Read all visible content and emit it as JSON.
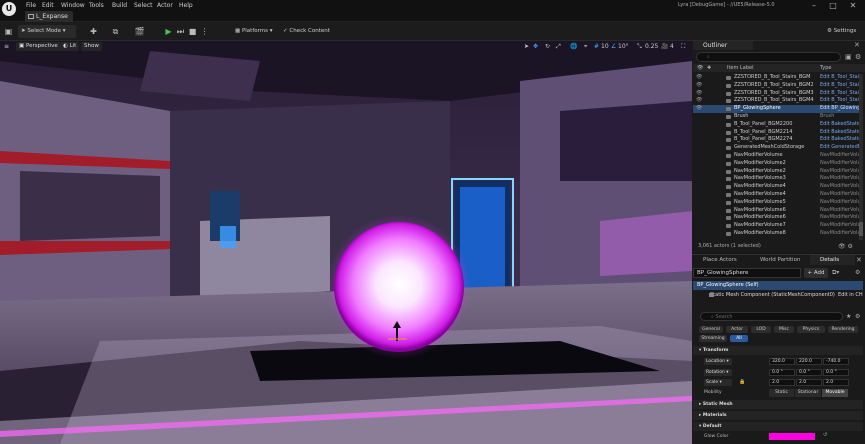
{
  "titlebar": {
    "logo": "U",
    "menus": [
      "File",
      "Edit",
      "Window",
      "Tools",
      "Build",
      "Select",
      "Actor",
      "Help"
    ],
    "project_tab": "L_Expanse",
    "window_title": "Lyra [DebugGame] - //UE5/Release-5.0",
    "controls": [
      "–",
      "□",
      "✕"
    ]
  },
  "toolbar": {
    "select_mode": "Select Mode",
    "platforms": "Platforms",
    "check_content": "Check Content",
    "settings": "Settings"
  },
  "viewport": {
    "perspective": "Perspective",
    "lit": "Lit",
    "show": "Show",
    "grid_snap": "10",
    "angle_snap": "10°",
    "scale_snap": "0.25",
    "camera_speed": "4"
  },
  "outliner": {
    "tab": "Outliner",
    "columns": {
      "label": "Item Label",
      "type": "Type"
    },
    "rows": [
      {
        "label": "ZZSTORED_B_Tool_Stairs_BGM",
        "type": "Edit B_Tool_Stai",
        "link": true,
        "eye": true
      },
      {
        "label": "ZZSTORED_B_Tool_Stairs_BGM2",
        "type": "Edit B_Tool_Stai",
        "link": true,
        "eye": true
      },
      {
        "label": "ZZSTORED_B_Tool_Stairs_BGM3",
        "type": "Edit B_Tool_Stai",
        "link": true,
        "eye": true
      },
      {
        "label": "ZZSTORED_B_Tool_Stairs_BGM4",
        "type": "Edit B_Tool_Stai",
        "link": true,
        "eye": true
      },
      {
        "label": "BP_GlowingSphere",
        "type": "Edit BP_Glowing",
        "link": true,
        "selected": true,
        "eye": true
      },
      {
        "label": "Brush",
        "type": "Brush",
        "link": false
      },
      {
        "label": "B_Tool_Panel_BGM2200",
        "type": "Edit BakedStatic",
        "link": true
      },
      {
        "label": "B_Tool_Panel_BGM2214",
        "type": "Edit BakedStatic",
        "link": true
      },
      {
        "label": "B_Tool_Panel_BGM2274",
        "type": "Edit BakedStatic",
        "link": true
      },
      {
        "label": "GeneratedMeshColdStorage",
        "type": "Edit GeneratedM",
        "link": true
      },
      {
        "label": "NavModifierVolume",
        "type": "NavModifierVolu",
        "link": false
      },
      {
        "label": "NavModifierVolume2",
        "type": "NavModifierVolu",
        "link": false
      },
      {
        "label": "NavModifierVolume2",
        "type": "NavModifierVolu",
        "link": false
      },
      {
        "label": "NavModifierVolume3",
        "type": "NavModifierVolu",
        "link": false
      },
      {
        "label": "NavModifierVolume4",
        "type": "NavModifierVolu",
        "link": false
      },
      {
        "label": "NavModifierVolume4",
        "type": "NavModifierVolu",
        "link": false
      },
      {
        "label": "NavModifierVolume5",
        "type": "NavModifierVolu",
        "link": false
      },
      {
        "label": "NavModifierVolume6",
        "type": "NavModifierVolu",
        "link": false
      },
      {
        "label": "NavModifierVolume6",
        "type": "NavModifierVolu",
        "link": false
      },
      {
        "label": "NavModifierVolume7",
        "type": "NavModifierVolu",
        "link": false
      },
      {
        "label": "NavModifierVolume8",
        "type": "NavModifierVolu",
        "link": false
      }
    ],
    "footer": "3,061 actors (1 selected)"
  },
  "details": {
    "tabs": [
      "Place Actors",
      "World Partition",
      "Details"
    ],
    "actor_name": "BP_GlowingSphere",
    "add_label": "Add",
    "self_row": "BP_GlowingSphere (Self)",
    "component_row": "Static Mesh Component (StaticMeshComponent0)",
    "component_edit": "Edit in CH",
    "search_placeholder": "Search",
    "filters": [
      "General",
      "Actor",
      "LOD",
      "Misc",
      "Physics",
      "Rendering",
      "Streaming",
      "All"
    ],
    "sections": {
      "transform": "Transform",
      "static_mesh": "Static Mesh",
      "materials": "Materials",
      "default": "Default"
    },
    "location": {
      "label": "Location",
      "x": "320.0",
      "y": "220.0",
      "z": "-740.0"
    },
    "rotation": {
      "label": "Rotation",
      "x": "0.0 °",
      "y": "0.0 °",
      "z": "0.0 °"
    },
    "scale": {
      "label": "Scale",
      "x": "2.0",
      "y": "2.0",
      "z": "2.0"
    },
    "mobility": {
      "label": "Mobility",
      "options": [
        "Static",
        "Stationar",
        "Movable"
      ],
      "selected": "Movable"
    },
    "glow_color_label": "Glow Color",
    "glow_color": "#ff00e0"
  },
  "colors": {
    "selection": "#2a4a72",
    "accent_link": "#7aa9e8",
    "glow": "#e040ff"
  }
}
